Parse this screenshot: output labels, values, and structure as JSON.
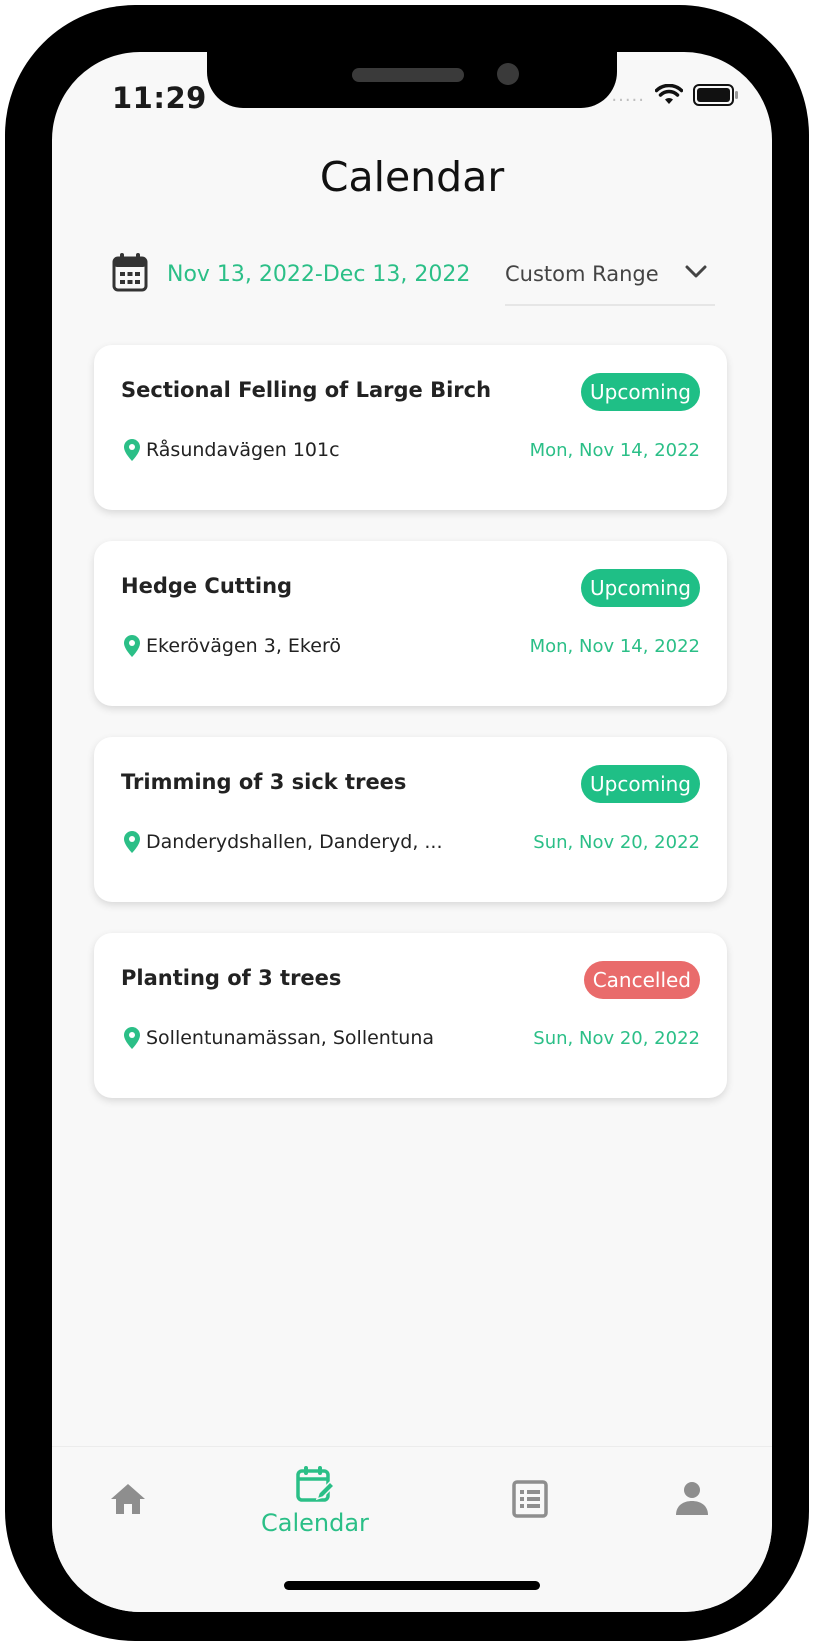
{
  "status_bar": {
    "time": "11:29",
    "signal": "....."
  },
  "header": {
    "title": "Calendar"
  },
  "range": {
    "dates": "Nov 13, 2022-Dec 13, 2022",
    "filter_label": "Custom Range"
  },
  "appointments": [
    {
      "title": "Sectional Felling of Large Birch",
      "status": "Upcoming",
      "location": "Råsundavägen 101c",
      "date": "Mon, Nov 14, 2022"
    },
    {
      "title": "Hedge Cutting",
      "status": "Upcoming",
      "location": "Ekerövägen 3, Ekerö",
      "date": "Mon, Nov 14, 2022"
    },
    {
      "title": "Trimming of 3 sick trees",
      "status": "Upcoming",
      "location": "Danderydshallen, Danderyd, ...",
      "date": "Sun, Nov 20, 2022"
    },
    {
      "title": "Planting of 3 trees",
      "status": "Cancelled",
      "location": "Sollentunamässan, Sollentuna",
      "date": "Sun, Nov 20, 2022"
    }
  ],
  "nav": {
    "items": [
      {
        "icon": "home-icon",
        "label": "",
        "active": false
      },
      {
        "icon": "calendar-edit-icon",
        "label": "Calendar",
        "active": true
      },
      {
        "icon": "list-icon",
        "label": "",
        "active": false
      },
      {
        "icon": "person-icon",
        "label": "",
        "active": false
      }
    ]
  },
  "colors": {
    "accent": "#2bbf87",
    "upcoming": "#1fbf86",
    "cancelled": "#e96b6b",
    "inactive_icon": "#8e8e8e"
  }
}
